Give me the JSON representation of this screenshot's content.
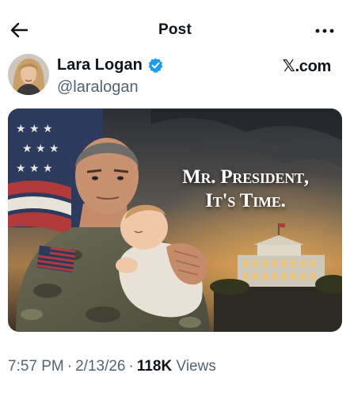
{
  "header": {
    "title": "Post",
    "back_icon": "arrow-left-icon",
    "more_icon": "more-horizontal-icon"
  },
  "post": {
    "author": {
      "display_name": "Lara Logan",
      "handle": "@laralogan",
      "verified_icon": "verified-badge-icon",
      "verified_color": "#1d9bf0"
    },
    "source": "𝕏.com",
    "media": {
      "headline_line1": "Mr. President,",
      "headline_line2": "It's Time."
    },
    "time": "7:57 PM",
    "date": "2/13/26",
    "separator": "·",
    "views_count": "118K",
    "views_label": "Views"
  },
  "colors": {
    "text_primary": "#0f1419",
    "text_secondary": "#536471",
    "accent": "#1d9bf0"
  }
}
